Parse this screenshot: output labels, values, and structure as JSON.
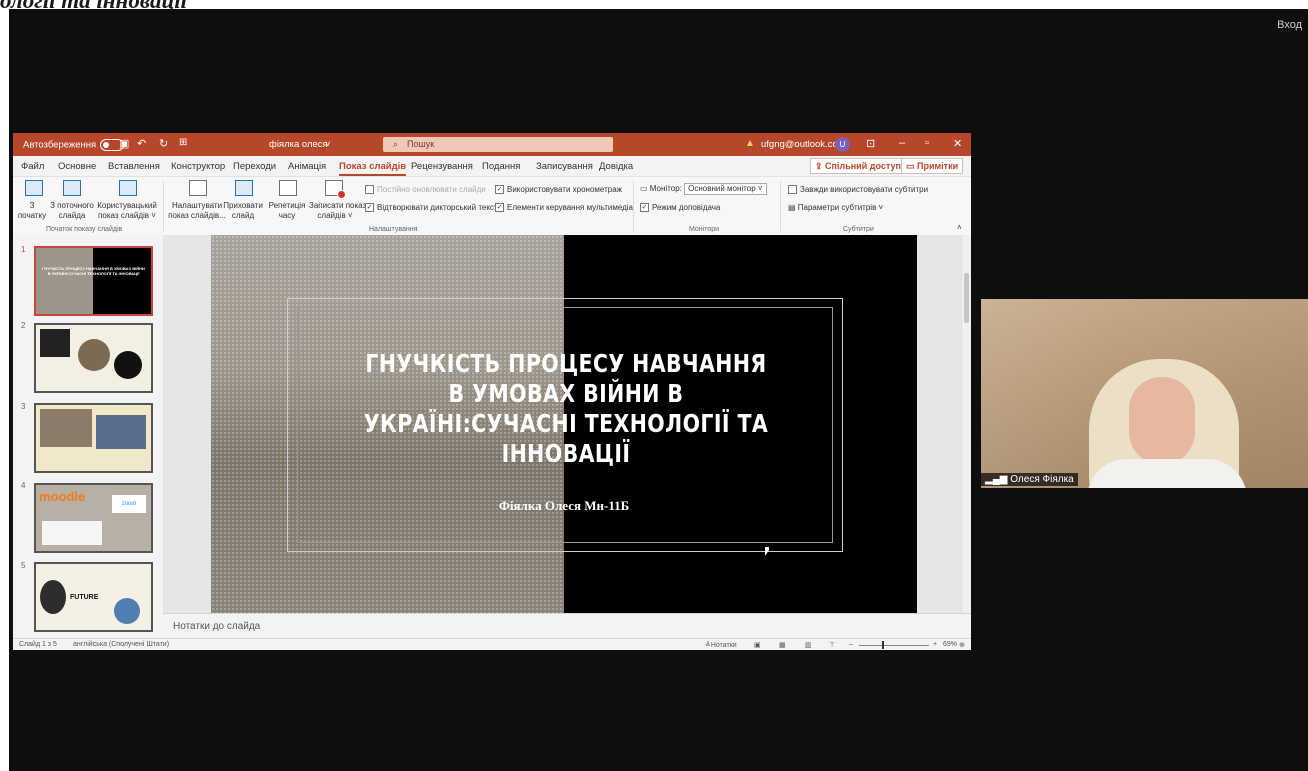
{
  "page_heading": "ології та інновації",
  "meeting": {
    "signin": "Вход"
  },
  "titlebar": {
    "autosave_label": "Автозбереження",
    "document": "фіялка олеся",
    "search_placeholder": "Пошук",
    "account": "ufgng@outlook.com",
    "avatar_initial": "U"
  },
  "menu": {
    "items": [
      "Файл",
      "Основне",
      "Вставлення",
      "Конструктор",
      "Переходи",
      "Анімація",
      "Показ слайдів",
      "Рецензування",
      "Подання",
      "Записування",
      "Довідка"
    ],
    "active": "Показ слайдів",
    "share": "Спільний доступ",
    "comments": "Примітки"
  },
  "ribbon": {
    "start_group": "Початок показу слайдів",
    "from_beginning": [
      "З",
      "початку"
    ],
    "from_current": [
      "З поточного",
      "слайда"
    ],
    "custom_show": [
      "Користувацький",
      "показ слайдів ˅"
    ],
    "setup_show": [
      "Налаштувати",
      "показ слайдів..."
    ],
    "hide_slide": [
      "Приховати",
      "слайд"
    ],
    "rehearse": [
      "Репетиція",
      "часу"
    ],
    "record": [
      "Записати показ",
      "слайдів ˅"
    ],
    "settings_group": "Налаштування",
    "keep_updated": "Постійно оновлювати слайди",
    "play_narrations": "Відтворювати дикторський текст",
    "use_timings": "Використовувати хронометраж",
    "media_controls": "Елементи керування мультимедіа",
    "monitors_group": "Монітори",
    "monitor_label": "Монітор:",
    "monitor_value": "Основний монітор",
    "presenter_view": "Режим доповідача",
    "captions_group": "Субтитри",
    "always_subtitles": "Завжди використовувати субтитри",
    "subtitle_settings": "Параметри субтитрів ˅"
  },
  "thumbnails": {
    "numbers": [
      "1",
      "2",
      "3",
      "4",
      "5"
    ],
    "slide1_title": "ГНУЧКІСТЬ ПРОЦЕСУ НАВЧАННЯ В УМОВАХ ВІЙНИ В УКРАЇНІ:СУЧАСНІ ТЕХНОЛОГІЇ ТА ІННОВАЦІЇ",
    "slide4_logo": "moodle",
    "slide4_zoom": "zoom",
    "slide5_word": "FUTURE"
  },
  "slide": {
    "title": "ГНУЧКІСТЬ ПРОЦЕСУ НАВЧАННЯ В УМОВАХ ВІЙНИ В УКРАЇНІ:СУЧАСНІ ТЕХНОЛОГІЇ ТА ІННОВАЦІЇ",
    "author": "Фіялка Олеся Мн-11Б"
  },
  "notes_placeholder": "Нотатки до слайда",
  "status": {
    "slide_count": "Слайд 1 з 5",
    "language": "англійська (Сполучені Штати)",
    "notes_button": "Нотатки",
    "zoom": "69%"
  },
  "webcam": {
    "participant": "Олеся Фіялка"
  },
  "colors": {
    "ppt_accent": "#b7472a",
    "meeting_bg": "#0e0e0e"
  }
}
